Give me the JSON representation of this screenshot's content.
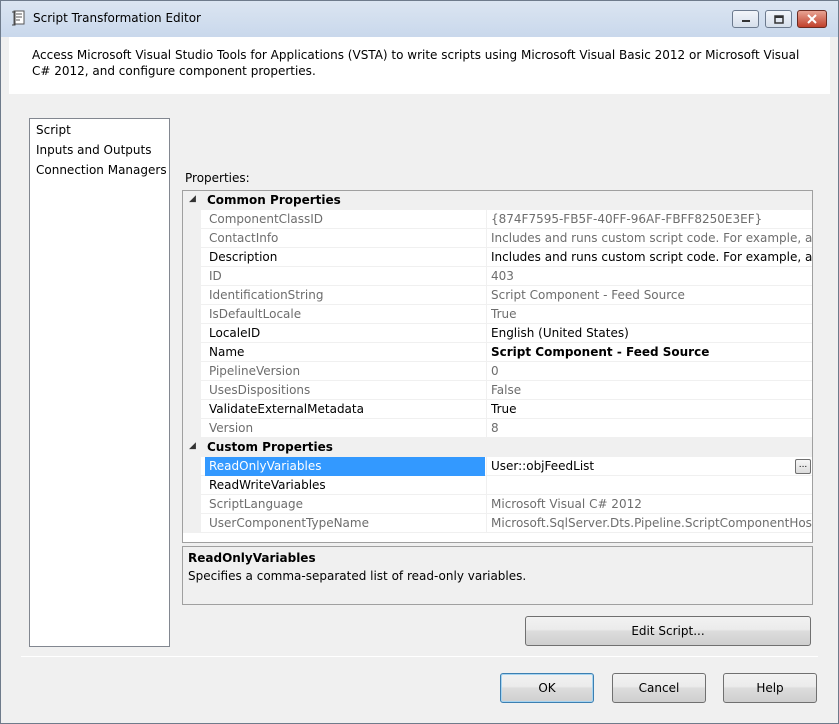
{
  "window": {
    "title": "Script Transformation Editor"
  },
  "description": "Access Microsoft Visual Studio Tools for Applications (VSTA) to write scripts using Microsoft Visual Basic 2012 or Microsoft Visual C# 2012, and configure component properties.",
  "nav": {
    "items": [
      {
        "label": "Script"
      },
      {
        "label": "Inputs and Outputs"
      },
      {
        "label": "Connection Managers"
      }
    ]
  },
  "properties": {
    "label": "Properties:",
    "categories": [
      {
        "name": "Common Properties",
        "rows": [
          {
            "name": "ComponentClassID",
            "value": "{874F7595-FB5F-40FF-96AF-FBFF8250E3EF}",
            "readonly": true
          },
          {
            "name": "ContactInfo",
            "value": "Includes and runs custom script code. For example, apply a b",
            "readonly": true
          },
          {
            "name": "Description",
            "value": "Includes and runs custom script code. For example, apply a b",
            "readonly": false
          },
          {
            "name": "ID",
            "value": "403",
            "readonly": true
          },
          {
            "name": "IdentificationString",
            "value": "Script Component - Feed Source",
            "readonly": true
          },
          {
            "name": "IsDefaultLocale",
            "value": "True",
            "readonly": true
          },
          {
            "name": "LocaleID",
            "value": "English (United States)",
            "readonly": false
          },
          {
            "name": "Name",
            "value": "Script Component - Feed Source",
            "readonly": false,
            "bold_value": true
          },
          {
            "name": "PipelineVersion",
            "value": "0",
            "readonly": true
          },
          {
            "name": "UsesDispositions",
            "value": "False",
            "readonly": true
          },
          {
            "name": "ValidateExternalMetadata",
            "value": "True",
            "readonly": false
          },
          {
            "name": "Version",
            "value": "8",
            "readonly": true
          }
        ]
      },
      {
        "name": "Custom Properties",
        "rows": [
          {
            "name": "ReadOnlyVariables",
            "value": "User::objFeedList",
            "readonly": false,
            "selected": true
          },
          {
            "name": "ReadWriteVariables",
            "value": "",
            "readonly": false
          },
          {
            "name": "ScriptLanguage",
            "value": "Microsoft Visual C# 2012",
            "readonly": true
          },
          {
            "name": "UserComponentTypeName",
            "value": "Microsoft.SqlServer.Dts.Pipeline.ScriptComponentHost, Micr",
            "readonly": true
          }
        ]
      }
    ],
    "ellipsis_label": "..."
  },
  "help": {
    "title": "ReadOnlyVariables",
    "text": "Specifies a comma-separated list of read-only variables."
  },
  "buttons": {
    "edit_script": "Edit Script...",
    "ok": "OK",
    "cancel": "Cancel",
    "help": "Help"
  },
  "colors": {
    "selection": "#3399ff",
    "readonly_text": "#6d6d6d"
  }
}
